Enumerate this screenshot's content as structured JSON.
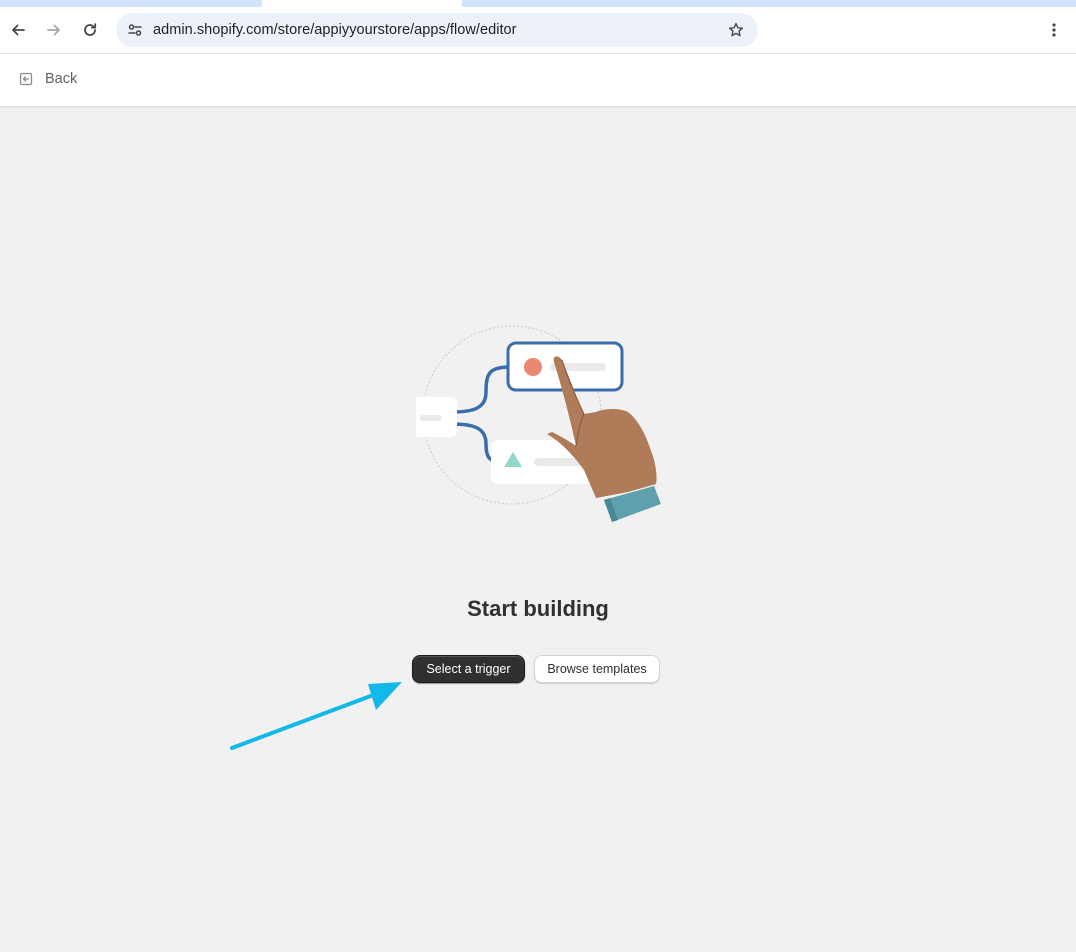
{
  "browser": {
    "url": "admin.shopify.com/store/appiyyourstore/apps/flow/editor",
    "icons": {
      "back": "arrow-left-icon",
      "forward": "arrow-right-icon",
      "reload": "reload-icon",
      "site_info": "tune-icon",
      "bookmark": "star-icon",
      "menu": "more-vertical-icon"
    }
  },
  "header": {
    "back_label": "Back",
    "back_icon": "exit-icon"
  },
  "main": {
    "title": "Start building",
    "primary_button": "Select a trigger",
    "secondary_button": "Browse templates"
  },
  "annotation": {
    "arrow_color": "#12b9e8"
  },
  "colors": {
    "page_bg": "#f1f1f1",
    "primary_button_bg": "#303030",
    "flow_line": "#3b6daa",
    "trigger_dot": "#ec8872",
    "triangle": "#8fd8cc",
    "hand_skin": "#b07b59",
    "cuff": "#5ea0ae"
  }
}
